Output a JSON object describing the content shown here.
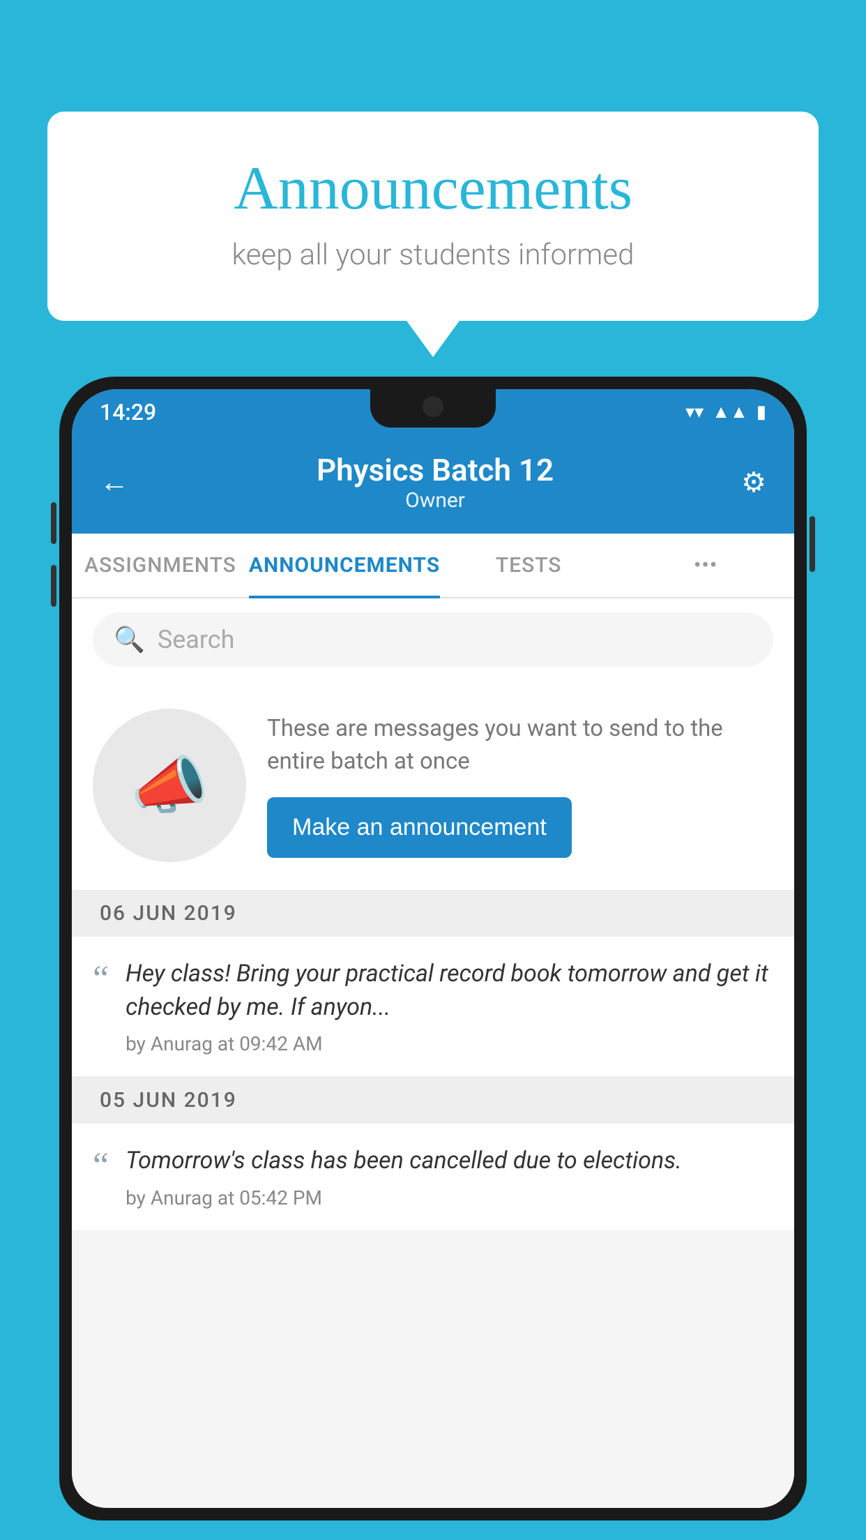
{
  "background_color": "#29b6d8",
  "bubble": {
    "title": "Announcements",
    "subtitle": "keep all your students informed"
  },
  "phone": {
    "status_bar": {
      "time": "14:29",
      "icons": [
        "wifi",
        "signal",
        "battery"
      ]
    },
    "header": {
      "title": "Physics Batch 12",
      "subtitle": "Owner",
      "back_label": "←",
      "settings_label": "⚙"
    },
    "tabs": [
      {
        "label": "ASSIGNMENTS",
        "active": false
      },
      {
        "label": "ANNOUNCEMENTS",
        "active": true
      },
      {
        "label": "TESTS",
        "active": false
      },
      {
        "label": "•••",
        "active": false
      }
    ],
    "search": {
      "placeholder": "Search"
    },
    "promo": {
      "description": "These are messages you want to send to the entire batch at once",
      "button_label": "Make an announcement"
    },
    "announcements": [
      {
        "date": "06  JUN  2019",
        "text": "Hey class! Bring your practical record book tomorrow and get it checked by me. If anyon...",
        "meta": "by Anurag at 09:42 AM"
      },
      {
        "date": "05  JUN  2019",
        "text": "Tomorrow's class has been cancelled due to elections.",
        "meta": "by Anurag at 05:42 PM"
      }
    ]
  }
}
